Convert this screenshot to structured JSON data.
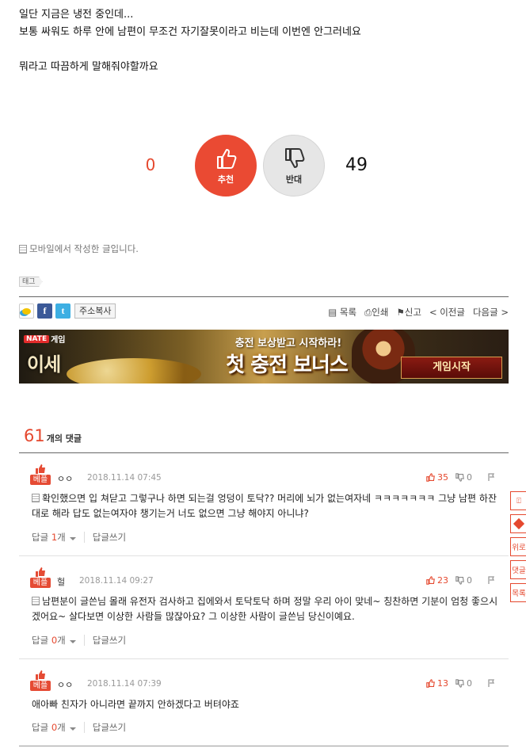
{
  "post": {
    "lines": [
      "일단 지금은 냉전 중인데...",
      "보통 싸워도 하루 안에 남편이 무조건 자기잘못이라고 비는데 이번엔 안그러네요",
      "",
      "뭐라고 따끔하게 말해줘야할까요"
    ]
  },
  "vote": {
    "up_count": "0",
    "up_label": "추천",
    "down_label": "반대",
    "down_count": "49"
  },
  "mobile_note": "모바일에서 작성한 글입니다.",
  "tag_label": "태그",
  "toolbar": {
    "copy_address": "주소복사",
    "list": "목록",
    "print": "인쇄",
    "report": "신고",
    "prev": "< 이전글",
    "next": "다음글 >"
  },
  "banner": {
    "brand": "NATE",
    "brand_suffix": "게임",
    "logo": "이세",
    "subtitle": "충전 보상받고 시작하라!",
    "headline": "첫 충전 보너스",
    "cta": "게임시작"
  },
  "comments_header": {
    "count": "61",
    "label": "개의 댓글"
  },
  "comments": [
    {
      "badge": "베플",
      "author": "ㅇㅇ",
      "date": "2018.11.14 07:45",
      "likes": "35",
      "dislikes": "0",
      "text": "확인했으면 입 쳐닫고 그렇구나 하면 되는걸 엉덩이 토닥?? 머리에 뇌가 없는여자네 ㅋㅋㅋㅋㅋㅋㅋ 그냥 남편 하잔대로 해라 답도 없는여자야 챙기는거 너도 없으면 그냥 해야지 아니냐?",
      "reply_label": "답글",
      "reply_count": "1",
      "reply_unit": "개",
      "write_reply": "답글쓰기"
    },
    {
      "badge": "베플",
      "author": "헐",
      "date": "2018.11.14 09:27",
      "likes": "23",
      "dislikes": "0",
      "text": "남편분이 글쓴님 몰래 유전자 검사하고 집에와서 토닥토닥 하며 정말 우리 아이 맞네~ 칭찬하면 기분이 엄청 좋으시겠어요~ 살다보면 이상한 사람들 많잖아요? 그 이상한 사람이 글쓴님 당신이예요.",
      "reply_label": "답글",
      "reply_count": "0",
      "reply_unit": "개",
      "write_reply": "답글쓰기"
    },
    {
      "badge": "베플",
      "author": "ㅇㅇ",
      "date": "2018.11.14 07:39",
      "likes": "13",
      "dislikes": "0",
      "text": "애아빠 친자가 아니라면 끝까지 안하겠다고 버텨야죠",
      "reply_label": "답글",
      "reply_count": "0",
      "reply_unit": "개",
      "write_reply": "답글쓰기"
    }
  ],
  "side_rail": [
    "위로",
    "댓글",
    "목록"
  ],
  "colors": {
    "accent": "#e5482e",
    "vote_up_bg": "#ea4a33",
    "vote_down_bg": "#e6e6e6"
  }
}
